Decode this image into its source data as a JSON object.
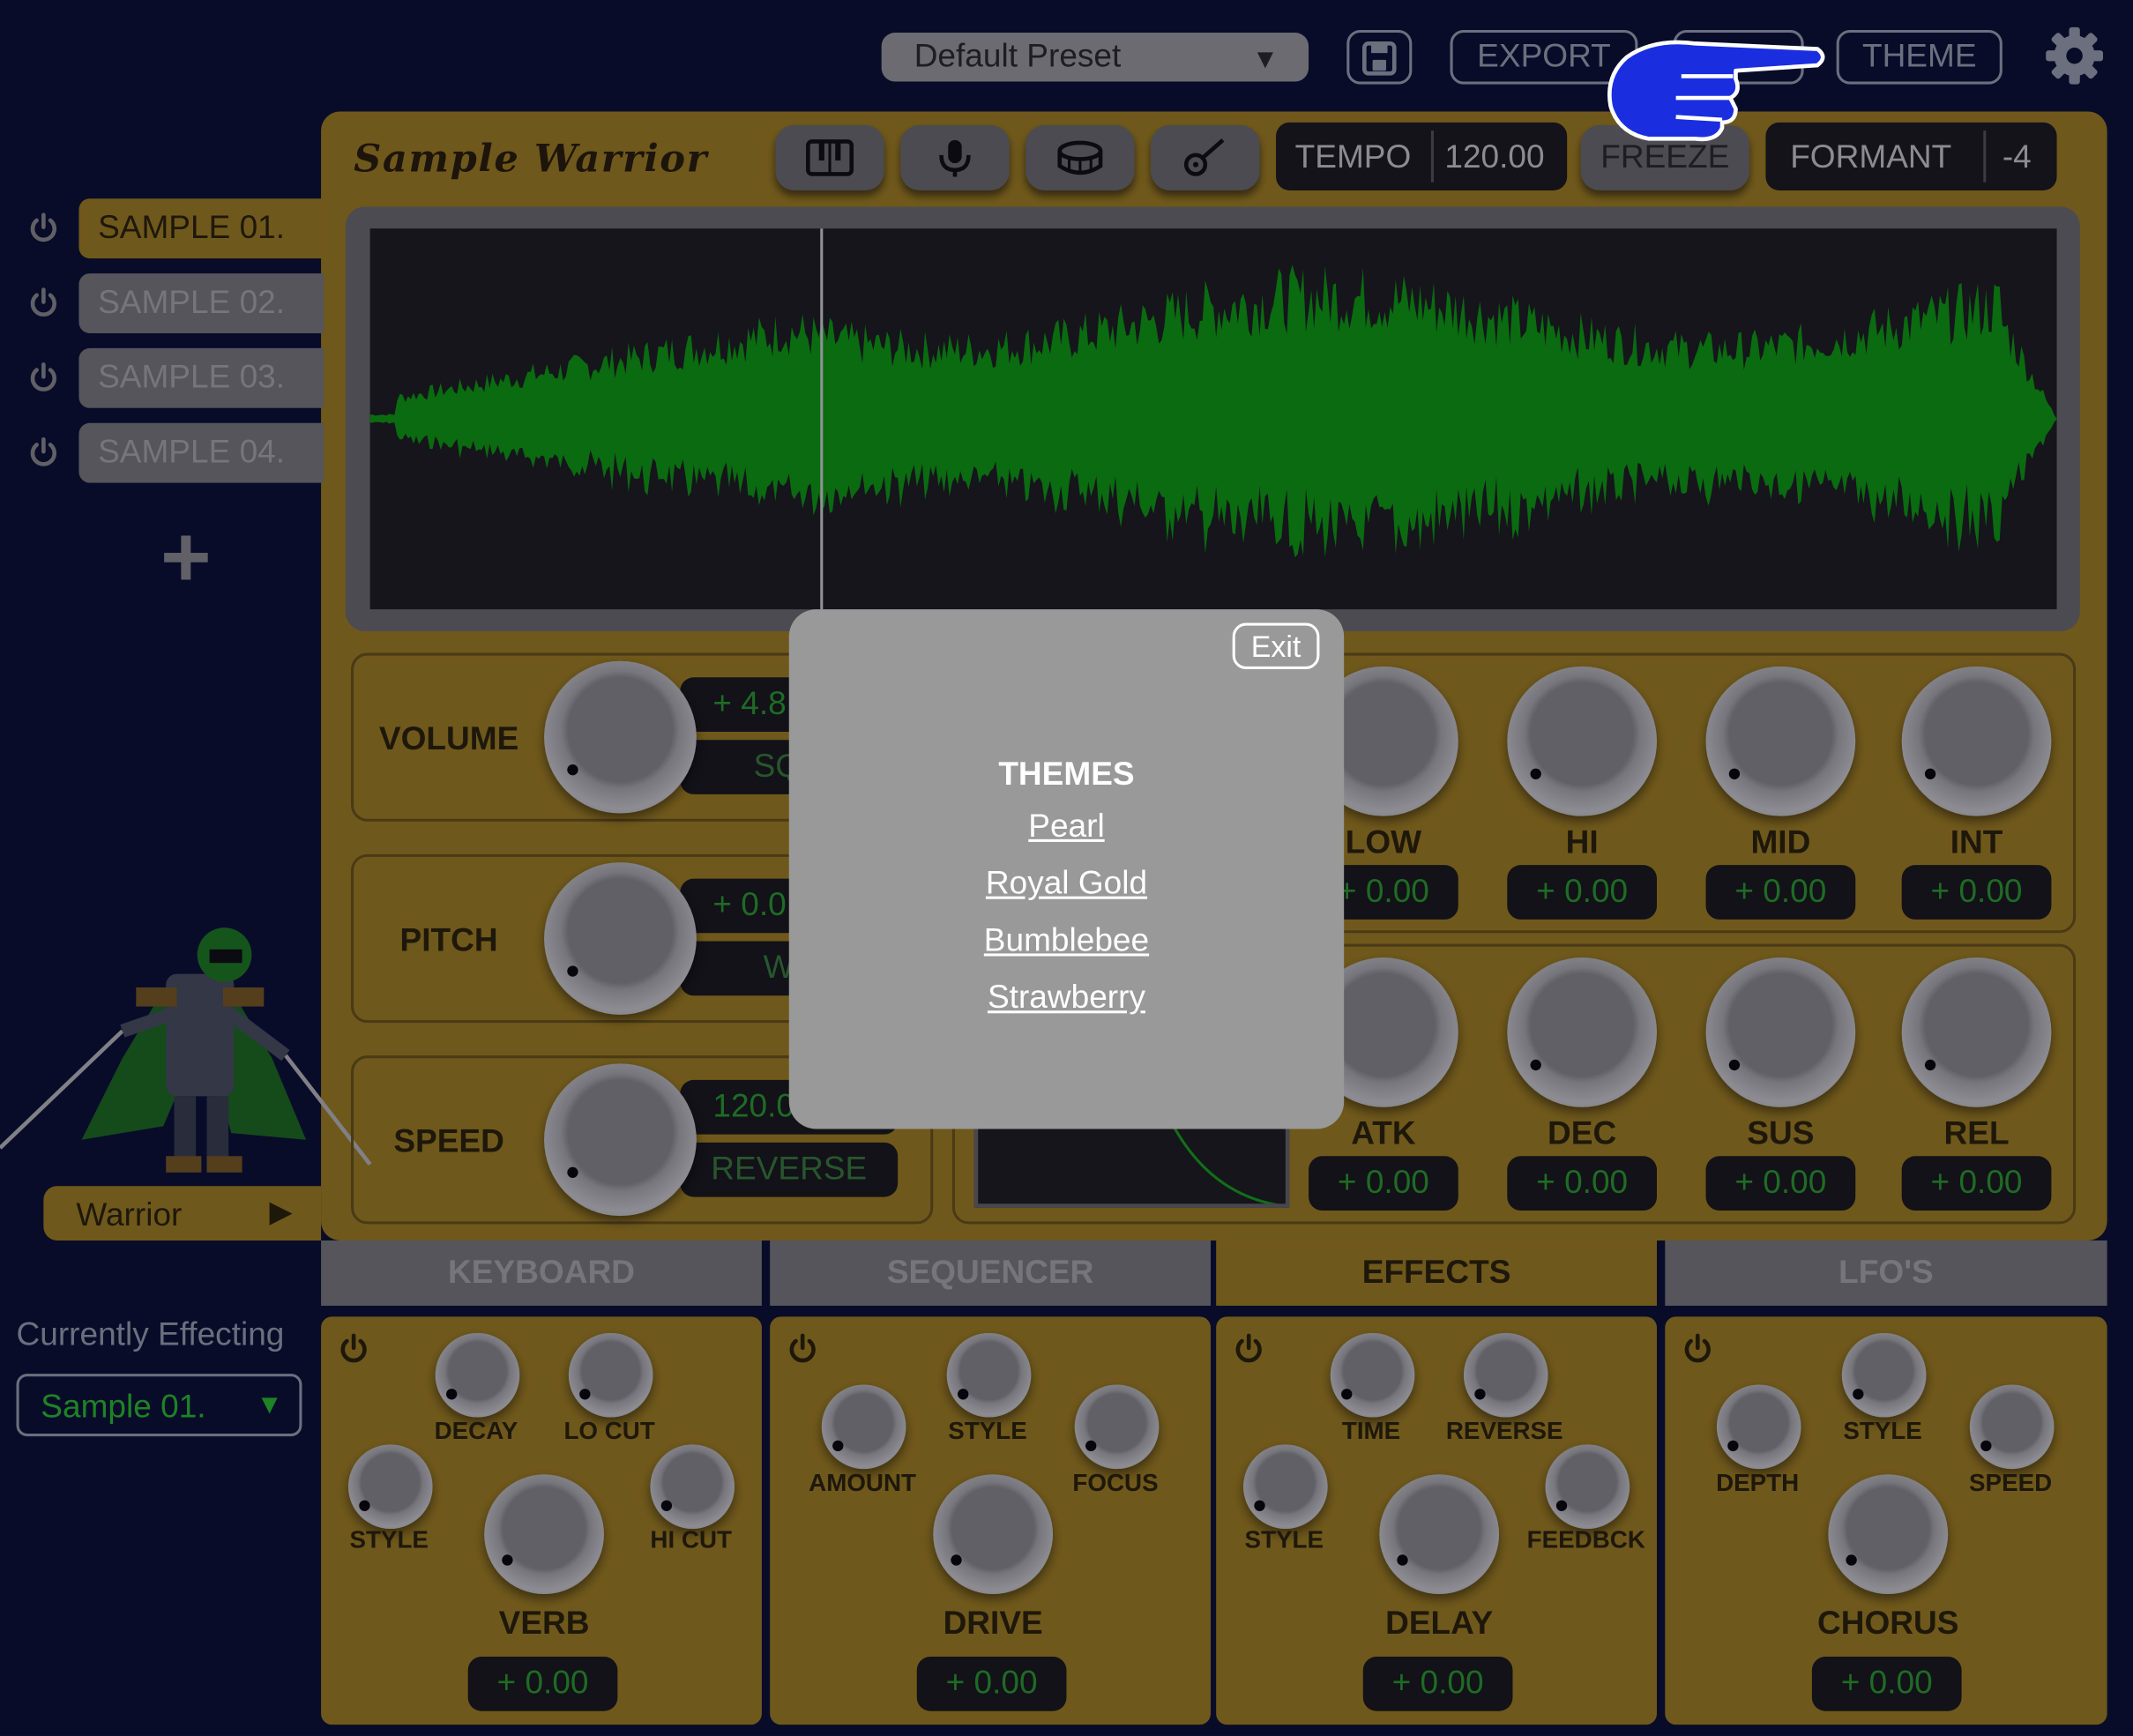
{
  "header": {
    "preset": "Default Preset",
    "export_label": "EXPORT",
    "theme_label": "THEME"
  },
  "app": {
    "title": "Sample Warrior",
    "tempo_label": "TEMPO",
    "tempo_value": "120.00",
    "freeze_label": "FREEZE",
    "formant_label": "FORMANT",
    "formant_value": "-4"
  },
  "samples": [
    {
      "label": "SAMPLE 01.",
      "active": true
    },
    {
      "label": "SAMPLE 02.",
      "active": false
    },
    {
      "label": "SAMPLE 03.",
      "active": false
    },
    {
      "label": "SAMPLE 04.",
      "active": false
    }
  ],
  "character": {
    "name": "Warrior"
  },
  "controls": {
    "volume": {
      "label": "VOLUME",
      "value": "+ 4.8",
      "option": "SQU"
    },
    "pitch": {
      "label": "PITCH",
      "value": "+ 0.0",
      "option": "WA"
    },
    "speed": {
      "label": "SPEED",
      "value": "120.0",
      "option": "REVERSE"
    }
  },
  "eq": [
    {
      "label": "LOW",
      "value": "+ 0.00"
    },
    {
      "label": "HI",
      "value": "+ 0.00"
    },
    {
      "label": "MID",
      "value": "+ 0.00"
    },
    {
      "label": "INT",
      "value": "+ 0.00"
    }
  ],
  "envelope": [
    {
      "label": "ATK",
      "value": "+ 0.00"
    },
    {
      "label": "DEC",
      "value": "+ 0.00"
    },
    {
      "label": "SUS",
      "value": "+ 0.00"
    },
    {
      "label": "REL",
      "value": "+ 0.00"
    }
  ],
  "tabs": [
    {
      "label": "KEYBOARD",
      "active": false
    },
    {
      "label": "SEQUENCER",
      "active": false
    },
    {
      "label": "EFFECTS",
      "active": true
    },
    {
      "label": "LFO'S",
      "active": false
    }
  ],
  "currently": {
    "label": "Currently Effecting",
    "value": "Sample 01."
  },
  "effects": [
    {
      "name": "VERB",
      "value": "+ 0.00",
      "labels": [
        "DECAY",
        "LO CUT",
        "STYLE",
        "HI CUT"
      ]
    },
    {
      "name": "DRIVE",
      "value": "+ 0.00",
      "labels": [
        "STYLE",
        "AMOUNT",
        "FOCUS"
      ]
    },
    {
      "name": "DELAY",
      "value": "+ 0.00",
      "labels": [
        "TIME",
        "REVERSE",
        "STYLE",
        "FEEDBCK"
      ]
    },
    {
      "name": "CHORUS",
      "value": "+ 0.00",
      "labels": [
        "STYLE",
        "DEPTH",
        "SPEED"
      ]
    }
  ],
  "modal": {
    "exit_label": "Exit",
    "title": "THEMES",
    "themes": [
      "Pearl",
      "Royal Gold",
      "Bumblebee",
      "Strawberry"
    ]
  },
  "colors": {
    "background": "#0c1233",
    "panel": "#a07f1f",
    "waveform": "#0f9a0f",
    "value_text": "#2d9a2d",
    "pointer": "#1a2ee0"
  }
}
